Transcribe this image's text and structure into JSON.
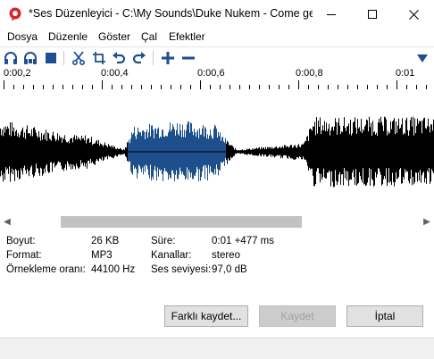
{
  "window": {
    "title": "*Ses Düzenleyici - C:\\My Sounds\\Duke Nukem - Come ge...",
    "app_icon": "red-speech-bubble-icon"
  },
  "menu": {
    "items": [
      "Dosya",
      "Düzenle",
      "Göster",
      "Çal",
      "Efektler"
    ]
  },
  "toolbar": {
    "icons": [
      "headphones-icon",
      "headphones-selection-icon",
      "stop-icon",
      "cut-icon",
      "crop-icon",
      "undo-icon",
      "redo-icon",
      "zoom-in-icon",
      "zoom-out-icon",
      "dropdown-icon"
    ],
    "accent_color": "#1e4f91"
  },
  "ruler": {
    "labels": [
      "0:00,2",
      "0:00,4",
      "0:00,6",
      "0:00,8",
      "0:01"
    ]
  },
  "waveform": {
    "selection_color": "#b3d7ff",
    "wave_color": "#000000",
    "selected_wave_color": "#1d4f8c"
  },
  "info": {
    "size_label": "Boyut:",
    "size_value": "26 KB",
    "format_label": "Format:",
    "format_value": "MP3",
    "samplerate_label": "Örnekleme oranı:",
    "samplerate_value": "44100 Hz",
    "duration_label": "Süre:",
    "duration_value": "0:01 +477 ms",
    "channels_label": "Kanallar:",
    "channels_value": "stereo",
    "volume_label": "Ses seviyesi:",
    "volume_value": "97,0 dB"
  },
  "buttons": {
    "save_as": "Farklı kaydet...",
    "save": "Kaydet",
    "cancel": "İptal"
  }
}
